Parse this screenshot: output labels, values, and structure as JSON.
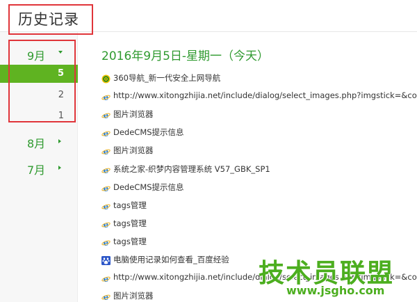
{
  "header": {
    "title": "历史记录"
  },
  "sidebar": {
    "months": [
      {
        "label": "9月",
        "expanded": true,
        "days": [
          "5",
          "2",
          "1"
        ],
        "active_day": "5"
      },
      {
        "label": "8月",
        "expanded": false
      },
      {
        "label": "7月",
        "expanded": false
      }
    ]
  },
  "content": {
    "date_heading": "2016年9月5日-星期一（今天）",
    "entries": [
      {
        "text": "360导航_新一代安全上网导航",
        "icon": "360-icon"
      },
      {
        "text": "http://www.xitongzhijia.net/include/dialog/select_images.php?imgstick=&comeback",
        "icon": "ie-icon"
      },
      {
        "text": "图片浏览器",
        "icon": "ie-icon"
      },
      {
        "text": "DedeCMS提示信息",
        "icon": "ie-icon"
      },
      {
        "text": "图片浏览器",
        "icon": "ie-icon"
      },
      {
        "text": "系统之家-织梦内容管理系统 V57_GBK_SP1",
        "icon": "ie-icon"
      },
      {
        "text": "DedeCMS提示信息",
        "icon": "ie-icon"
      },
      {
        "text": "tags管理",
        "icon": "ie-icon"
      },
      {
        "text": "tags管理",
        "icon": "ie-icon"
      },
      {
        "text": "tags管理",
        "icon": "ie-icon"
      },
      {
        "text": "电脑使用记录如何查看_百度经验",
        "icon": "baidu-paw-icon"
      },
      {
        "text": "http://www.xitongzhijia.net/include/dialog/select_images.php?imgstick=&comeback",
        "icon": "ie-icon"
      },
      {
        "text": "图片浏览器",
        "icon": "ie-icon"
      }
    ]
  },
  "watermark": {
    "text": "技术员联盟",
    "url": "www.jsgho.com"
  },
  "colors": {
    "accent_green": "#2f9a2f",
    "active_day_bg": "#5fb321",
    "highlight_red": "#e0353a"
  }
}
